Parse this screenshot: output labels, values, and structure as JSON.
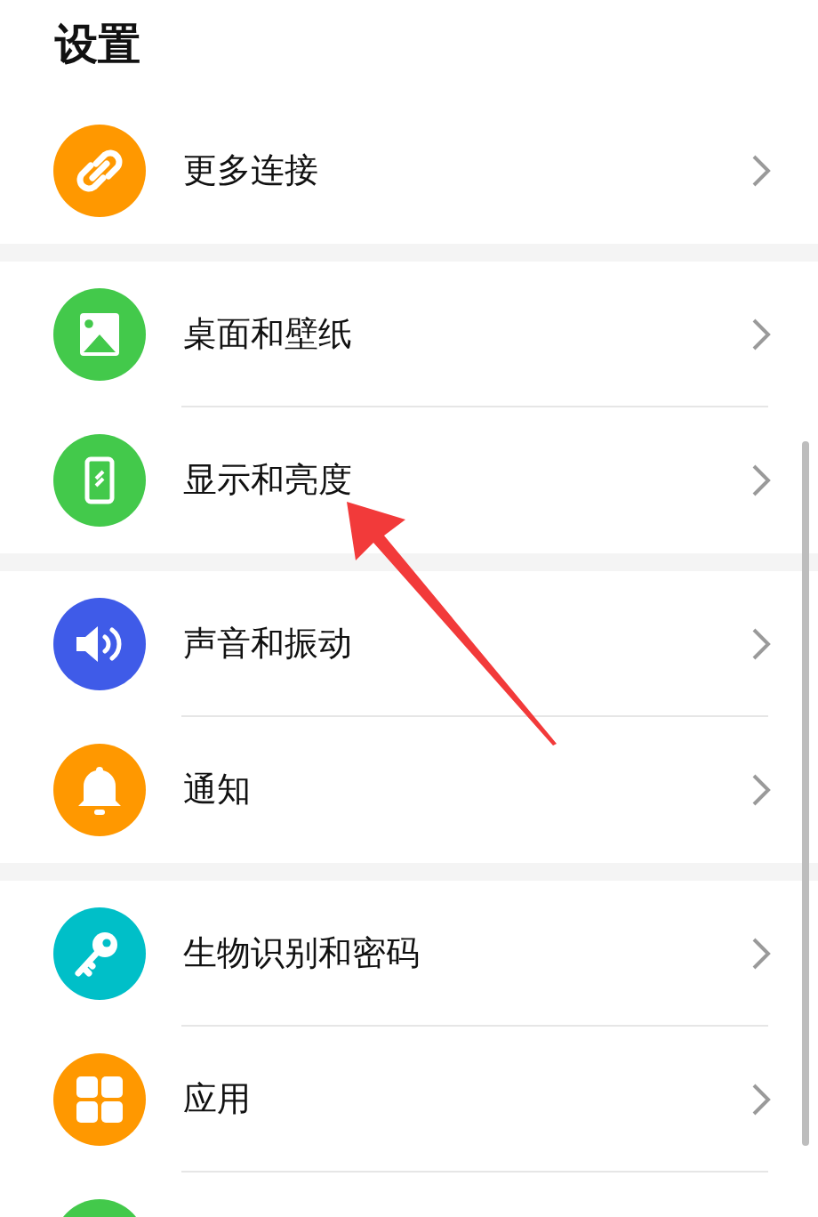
{
  "title": "设置",
  "groups": [
    {
      "items": [
        {
          "label": "更多连接",
          "kind": "link",
          "color": "#ff9800"
        }
      ]
    },
    {
      "items": [
        {
          "label": "桌面和壁纸",
          "kind": "image",
          "color": "#43c94b"
        },
        {
          "label": "显示和亮度",
          "kind": "phone",
          "color": "#43c94b"
        }
      ]
    },
    {
      "items": [
        {
          "label": "声音和振动",
          "kind": "speaker",
          "color": "#3f5be8"
        },
        {
          "label": "通知",
          "kind": "bell",
          "color": "#ff9800"
        }
      ]
    },
    {
      "items": [
        {
          "label": "生物识别和密码",
          "kind": "key",
          "color": "#00bfc8"
        },
        {
          "label": "应用",
          "kind": "grid",
          "color": "#ff9800"
        },
        {
          "kind": "blank",
          "color": "#43c94b"
        }
      ]
    }
  ],
  "annotations": [
    {
      "kind": "arrow"
    }
  ]
}
